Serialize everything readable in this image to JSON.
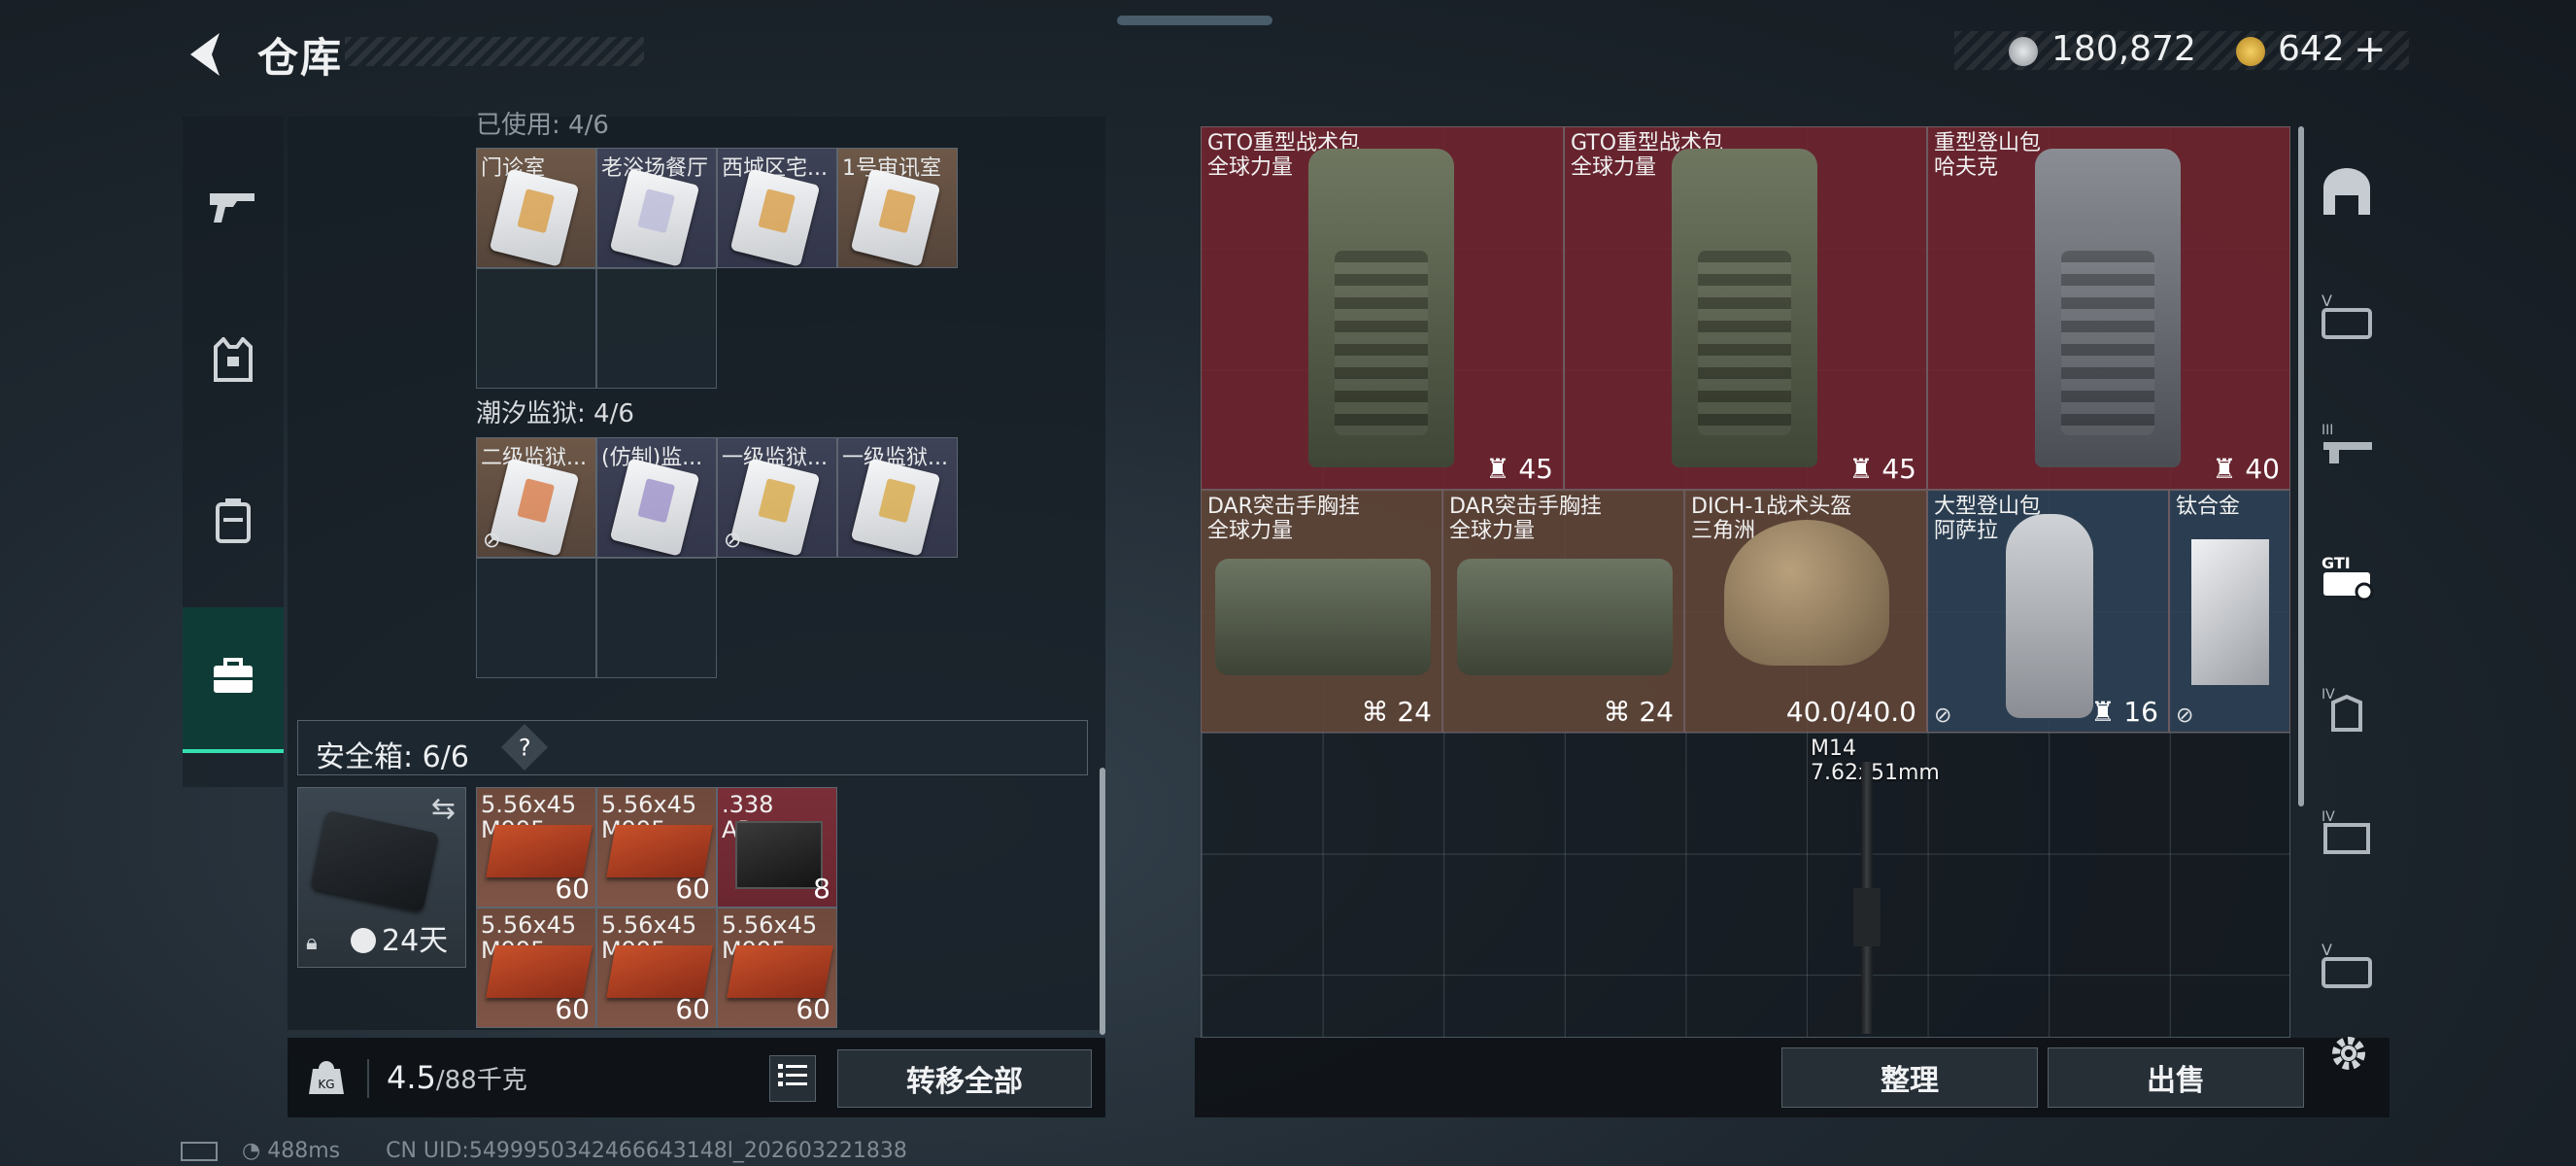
{
  "header": {
    "title": "仓库"
  },
  "currency": {
    "silver": "180,872",
    "gold": "642",
    "gold_add": "+"
  },
  "left_nav": [
    {
      "id": "weapons",
      "icon": "gun-icon"
    },
    {
      "id": "armor",
      "icon": "vest-icon"
    },
    {
      "id": "backpack",
      "icon": "backpack-icon"
    },
    {
      "id": "safebox",
      "icon": "briefcase-icon",
      "active": true
    }
  ],
  "stash": {
    "section1_title": "已使用: 4/6",
    "section1_cards": [
      {
        "label": "门诊室",
        "color": "#d89a3c"
      },
      {
        "label": "老浴场餐厅",
        "color": "#b8b8d8"
      },
      {
        "label": "西城区宅...",
        "color": "#d89a3c"
      },
      {
        "label": "1号审讯室",
        "color": "#d89a3c"
      }
    ],
    "section2_title": "潮汐监狱: 4/6",
    "section2_cards": [
      {
        "label": "二级监狱...",
        "color": "#d8743c",
        "nosell": "⊘"
      },
      {
        "label": "(仿制)监...",
        "color": "#9a8cc8"
      },
      {
        "label": "一级监狱...",
        "color": "#d8a63c",
        "nosell": "⊘"
      },
      {
        "label": "一级监狱...",
        "color": "#d8a63c"
      }
    ]
  },
  "safebox": {
    "label": "安全箱: 6/6",
    "help": "?",
    "days": "24天",
    "ammo": [
      {
        "name": "5.56x45\nM995",
        "qty": "60"
      },
      {
        "name": "5.56x45\nM995",
        "qty": "60"
      },
      {
        "name": ".338\nAP",
        "qty": "8"
      },
      {
        "name": "5.56x45\nM995",
        "qty": "60"
      },
      {
        "name": "5.56x45\nM995",
        "qty": "60"
      },
      {
        "name": "5.56x45\nM995",
        "qty": "60"
      }
    ]
  },
  "weight": {
    "current": "4.5",
    "max": "/88千克"
  },
  "transfer_all_label": "转移全部",
  "container_items": [
    {
      "name": "GTO重型战术包\n全球力量",
      "value": "45",
      "rarity": "red"
    },
    {
      "name": "GTO重型战术包\n全球力量",
      "value": "45",
      "rarity": "red"
    },
    {
      "name": "重型登山包\n哈夫克",
      "value": "40",
      "rarity": "red"
    },
    {
      "name": "DAR突击手胸挂\n全球力量",
      "value": "24",
      "rarity": "brown"
    },
    {
      "name": "DAR突击手胸挂\n全球力量",
      "value": "24",
      "rarity": "brown"
    },
    {
      "name": "DICH-1战术头盔\n三角洲",
      "value": "40.0/40.0",
      "rarity": "brown"
    },
    {
      "name": "大型登山包\n阿萨拉",
      "value": "16",
      "rarity": "blue",
      "nosell": "⊘"
    },
    {
      "name": "钛合金",
      "value": "",
      "rarity": "blue",
      "nosell": "⊘"
    },
    {
      "name": "M14\n7.62x51mm",
      "value": "",
      "rarity": "none"
    }
  ],
  "buttons": {
    "organize": "整理",
    "sell": "出售"
  },
  "status": {
    "ping": "488ms",
    "uid": "CN UID:5499950342466643148l_202603221838"
  },
  "right_nav": [
    "roof-icon",
    "v-case-icon",
    "iii-rifle-icon",
    "gti-case-icon",
    "iv-armor-icon",
    "iv-box-icon",
    "v-case2-icon"
  ],
  "colors": {
    "accent": "#35e0b0",
    "red_rarity": "#73262f",
    "brown_rarity": "#604638",
    "blue_rarity": "#2e4256"
  }
}
